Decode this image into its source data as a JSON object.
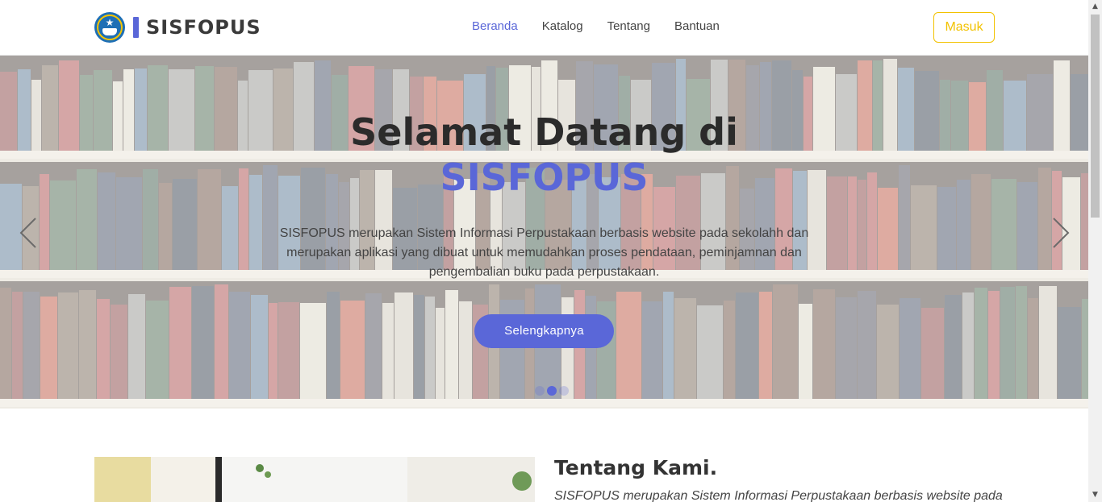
{
  "navbar": {
    "brand_name": "SISFOPUS",
    "links": [
      "Beranda",
      "Katalog",
      "Tentang",
      "Bantuan"
    ],
    "active_link": "Beranda",
    "login_label": "Masuk"
  },
  "hero": {
    "title_line1": "Selamat Datang di",
    "title_line2": "SISFOPUS",
    "description": "SISFOPUS merupakan Sistem Informasi Perpustakaan berbasis website pada sekolahh dan merupakan aplikasi yang dibuat untuk memudahkan proses pendataan, peminjamnan dan pengembalian buku pada perpustakaan.",
    "button_label": "Selengkapnya",
    "slide_count": 3,
    "active_slide": 2
  },
  "about": {
    "title": "Tentang Kami.",
    "text": "SISFOPUS merupakan Sistem Informasi Perpustakaan berbasis website pada"
  },
  "colors": {
    "accent": "#5a67d8",
    "login_border": "#f2c200",
    "text_dark": "#2b2b2b"
  },
  "icons": {
    "prev": "chevron-left-icon",
    "next": "chevron-right-icon",
    "logo": "tut-wuri-handayani-logo"
  }
}
